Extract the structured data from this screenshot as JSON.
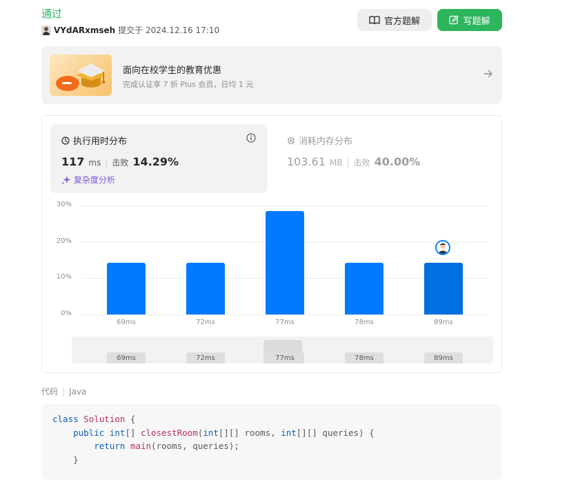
{
  "submission": {
    "status": "通过",
    "username": "VYdARxmseh",
    "submitted_at": "提交于 2024.12.16 17:10"
  },
  "buttons": {
    "official_solution": "官方题解",
    "write_solution": "写题解"
  },
  "promo": {
    "title": "面向在校学生的教育优惠",
    "subtitle": "完成认证享 7 折 Plus 会员，日均 1 元"
  },
  "runtime": {
    "title": "执行用时分布",
    "value": "117",
    "unit": "ms",
    "beats_label": "击败",
    "beats": "14.29%",
    "complexity_link": "复杂度分析"
  },
  "memory": {
    "title": "消耗内存分布",
    "value": "103.61",
    "unit": "MB",
    "beats_label": "击败",
    "beats": "40.00%"
  },
  "chart_data": {
    "type": "bar",
    "categories": [
      "69ms",
      "72ms",
      "77ms",
      "78ms",
      "89ms"
    ],
    "values": [
      14.29,
      14.29,
      28.57,
      14.29,
      14.29
    ],
    "y_ticks": [
      "0%",
      "10%",
      "20%",
      "30%"
    ],
    "ylim": [
      0,
      30
    ],
    "highlight_category": "89ms",
    "colors": {
      "bar": "#007aff",
      "highlight": "#006fe0"
    },
    "grid": true
  },
  "code": {
    "label": "代码",
    "language": "Java",
    "lines": [
      [
        [
          "kw",
          "class"
        ],
        [
          "pun",
          " "
        ],
        [
          "cls",
          "Solution"
        ],
        [
          "pun",
          " {"
        ]
      ],
      [
        [
          "pun",
          "    "
        ],
        [
          "kw",
          "public"
        ],
        [
          "pun",
          " "
        ],
        [
          "kw",
          "int"
        ],
        [
          "pun",
          "[] "
        ],
        [
          "fn",
          "closestRoom"
        ],
        [
          "pun",
          "("
        ],
        [
          "kw",
          "int"
        ],
        [
          "pun",
          "[][] "
        ],
        [
          "pun",
          "rooms, "
        ],
        [
          "kw",
          "int"
        ],
        [
          "pun",
          "[][] "
        ],
        [
          "pun",
          "queries) {"
        ]
      ],
      [
        [
          "pun",
          "        "
        ],
        [
          "kw",
          "return"
        ],
        [
          "pun",
          " "
        ],
        [
          "fn",
          "main"
        ],
        [
          "pun",
          "(rooms, queries);"
        ]
      ],
      [
        [
          "pun",
          "    }"
        ]
      ]
    ]
  },
  "icons": {
    "official": "book-icon",
    "write": "edit-icon",
    "arrow": "arrow-right-icon",
    "clock": "clock-icon",
    "info": "info-icon",
    "sparkle": "sparkle-icon",
    "chip": "chip-icon"
  }
}
